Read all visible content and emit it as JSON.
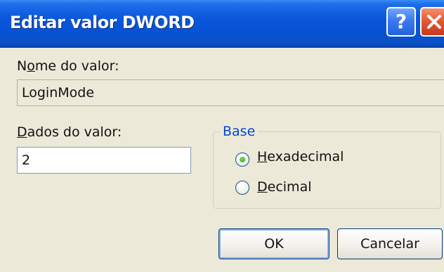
{
  "window": {
    "title": "Editar valor DWORD",
    "help_glyph": "?"
  },
  "value_name": {
    "label_before": "N",
    "label_accel": "o",
    "label_after": "me do valor:",
    "value": "LoginMode"
  },
  "value_data": {
    "label_before": "",
    "label_accel": "D",
    "label_after": "ados do valor:",
    "value": "2"
  },
  "base": {
    "legend": "Base",
    "options": [
      {
        "label_accel": "H",
        "label_after": "exadecimal",
        "selected": true
      },
      {
        "label_accel": "D",
        "label_after": "ecimal",
        "selected": false
      }
    ]
  },
  "buttons": {
    "ok_label": "OK",
    "cancel_label": "Cancelar"
  },
  "colors": {
    "titlebar": "#0a56dc",
    "dialog_bg": "#ece9d8",
    "legend_text": "#0046d5",
    "close_button": "#e65a35"
  }
}
